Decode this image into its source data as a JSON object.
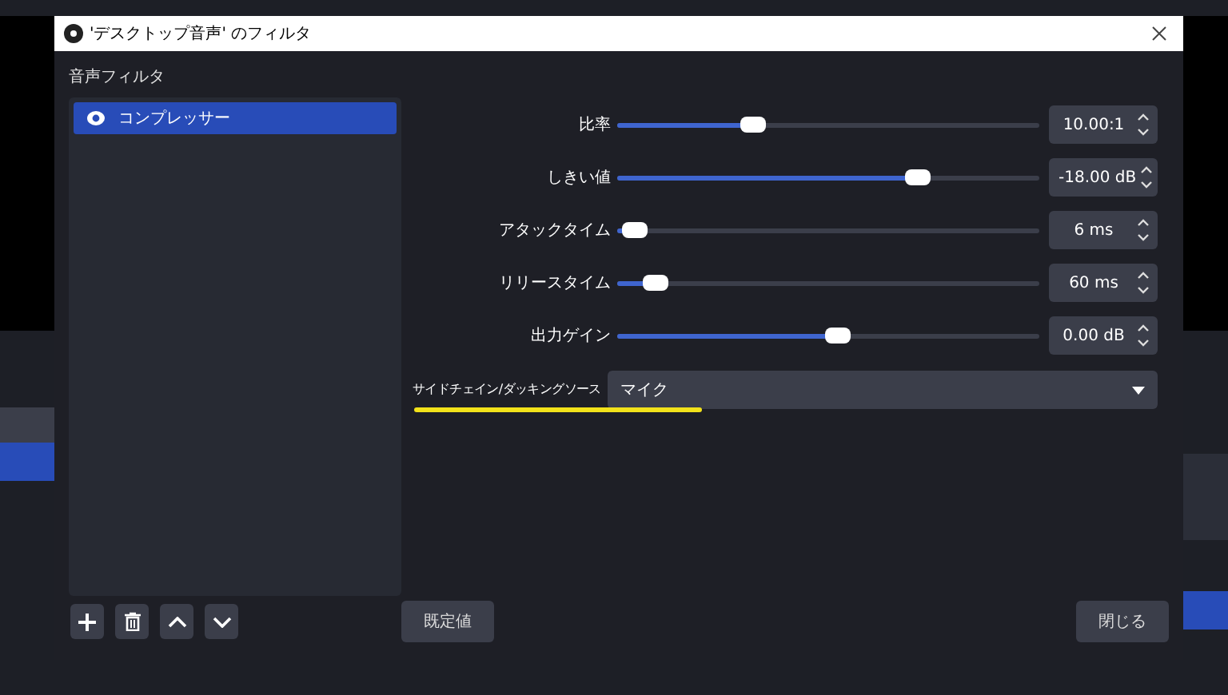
{
  "window": {
    "title": "'デスクトップ音声' のフィルタ"
  },
  "filters": {
    "label": "音声フィルタ",
    "items": [
      {
        "name": "コンプレッサー",
        "visible": true,
        "selected": true
      }
    ]
  },
  "params": [
    {
      "label": "比率",
      "level": 0.3,
      "value": "10.00:1"
    },
    {
      "label": "しきい値",
      "level": 0.69,
      "value": "-18.00 dB"
    },
    {
      "label": "アタックタイム",
      "level": 0.02,
      "value": "6 ms"
    },
    {
      "label": "リリースタイム",
      "level": 0.07,
      "value": "60 ms"
    },
    {
      "label": "出力ゲイン",
      "level": 0.5,
      "value": "0.00 dB"
    }
  ],
  "sidechain": {
    "label": "サイドチェイン/ダッキングソース",
    "value": "マイク"
  },
  "buttons": {
    "defaults": "既定値",
    "close": "閉じる"
  }
}
